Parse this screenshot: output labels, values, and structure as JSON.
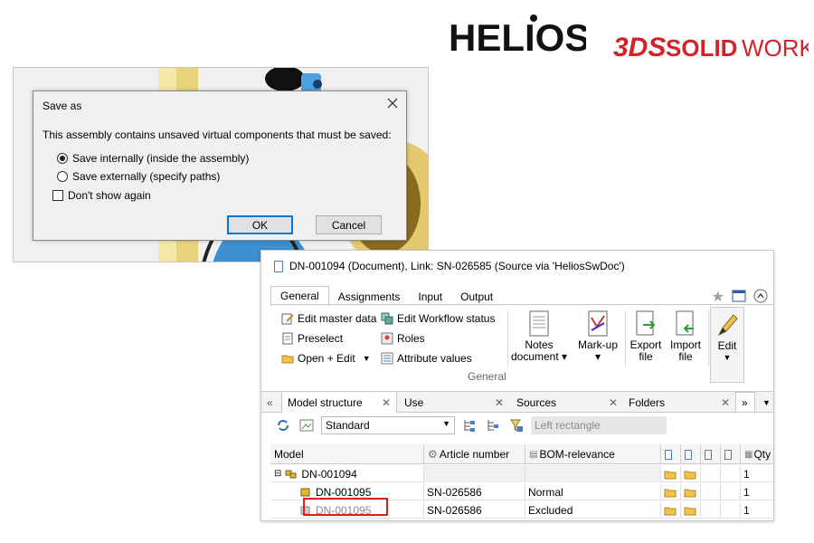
{
  "logos": {
    "helios": "HELIOS",
    "solidworks": "SOLIDWORKS",
    "solidworks_mark": "3DS"
  },
  "dialog": {
    "title": "Save as",
    "message": "This assembly contains unsaved virtual components that must be saved:",
    "option_internal": "Save internally (inside the assembly)",
    "option_external": "Save externally (specify paths)",
    "selected_option": "internal",
    "dont_show": "Don't show again",
    "ok": "OK",
    "cancel": "Cancel"
  },
  "panel": {
    "title": "DN-001094 (Document), Link: SN-026585 (Source via 'HeliosSwDoc')",
    "tabs": [
      "General",
      "Assignments",
      "Input",
      "Output"
    ],
    "ribbon": {
      "edit_master_data": "Edit master data",
      "edit_workflow_status": "Edit Workflow status",
      "preselect": "Preselect",
      "roles": "Roles",
      "open_edit": "Open + Edit",
      "attribute_values": "Attribute values",
      "notes_line1": "Notes",
      "notes_line2": "document",
      "markup": "Mark-up",
      "export_line1": "Export",
      "export_line2": "file",
      "import_line1": "Import",
      "import_line2": "file",
      "edit": "Edit",
      "group_label": "General"
    },
    "subtabs": [
      "Model structure",
      "Use",
      "Sources",
      "Folders"
    ],
    "view_select": "Standard",
    "filter_placeholder": "Left rectangle",
    "grid": {
      "headers": [
        "Model",
        "Article number",
        "BOM-relevance",
        "Qty"
      ],
      "rows": [
        {
          "model": "DN-001094",
          "article": "",
          "bom": "",
          "qty": "1"
        },
        {
          "model": "DN-001095",
          "article": "SN-026586",
          "bom": "Normal",
          "qty": "1"
        },
        {
          "model": "DN-001095",
          "article": "SN-026586",
          "bom": "Excluded",
          "qty": "1"
        }
      ]
    }
  },
  "colors": {
    "accent_blue": "#0078d7",
    "highlight_red": "#e02020",
    "solidworks_red": "#d2232a"
  }
}
